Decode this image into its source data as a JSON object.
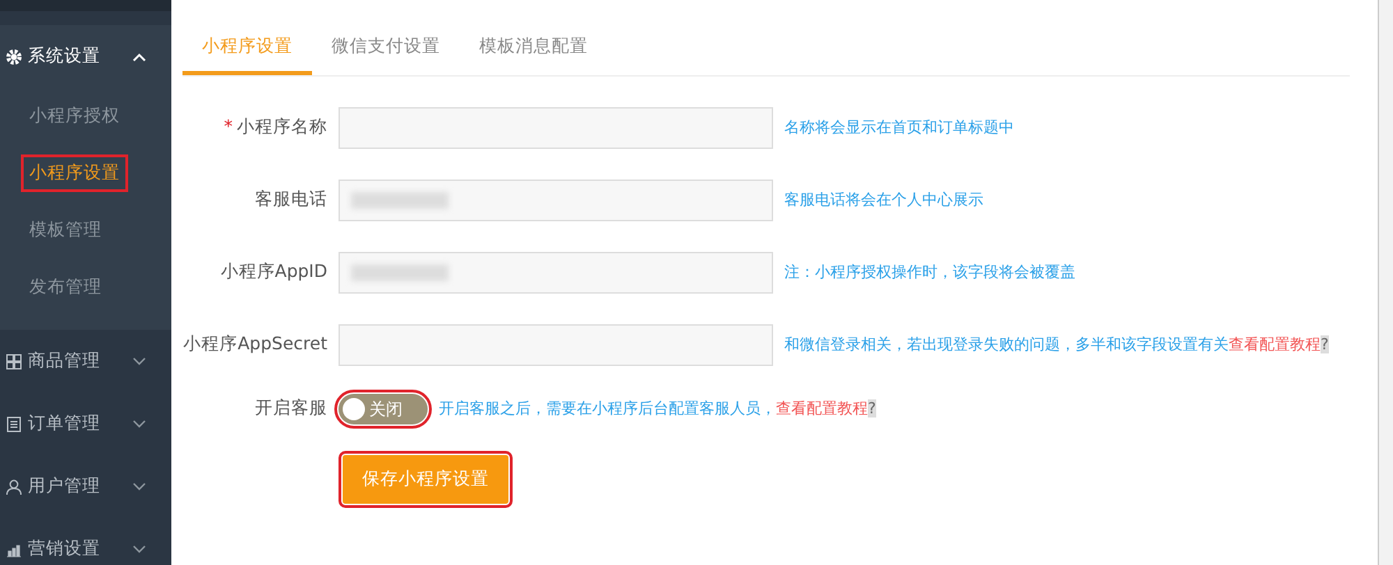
{
  "sidebar": {
    "groups": [
      {
        "label": "系统设置",
        "expanded": true,
        "children": [
          {
            "label": "小程序授权",
            "selected": false
          },
          {
            "label": "小程序设置",
            "selected": true,
            "highlighted": true
          },
          {
            "label": "模板管理",
            "selected": false
          },
          {
            "label": "发布管理",
            "selected": false
          }
        ]
      },
      {
        "label": "商品管理",
        "expanded": false
      },
      {
        "label": "订单管理",
        "expanded": false
      },
      {
        "label": "用户管理",
        "expanded": false
      },
      {
        "label": "营销设置",
        "expanded": false
      }
    ]
  },
  "tabs": [
    {
      "label": "小程序设置",
      "selected": true
    },
    {
      "label": "微信支付设置",
      "selected": false
    },
    {
      "label": "模板消息配置",
      "selected": false
    }
  ],
  "form": {
    "fields": [
      {
        "kind": "input",
        "label": "小程序名称",
        "required_mark": "*",
        "hint": "名称将会显示在首页和订单标题中"
      },
      {
        "kind": "input",
        "label": "客服电话",
        "redacted": true,
        "hint": "客服电话将会在个人中心展示"
      },
      {
        "kind": "input",
        "label": "小程序AppID",
        "redacted": true,
        "hint": "注：小程序授权操作时，该字段将会被覆盖"
      },
      {
        "kind": "input",
        "label": "小程序AppSecret",
        "hint": "和微信登录相关，若出现登录失败的问题，多半和该字段设置有关",
        "link": "查看配置教程",
        "mark": "?"
      },
      {
        "kind": "switch",
        "label": "开启客服",
        "on": false,
        "switch_text": "关闭",
        "highlighted": true,
        "hint": "开启客服之后，需要在小程序后台配置客服人员，",
        "link": "查看配置教程",
        "mark": "?"
      }
    ],
    "save_button": {
      "label": "保存小程序设置",
      "highlighted": true
    }
  }
}
